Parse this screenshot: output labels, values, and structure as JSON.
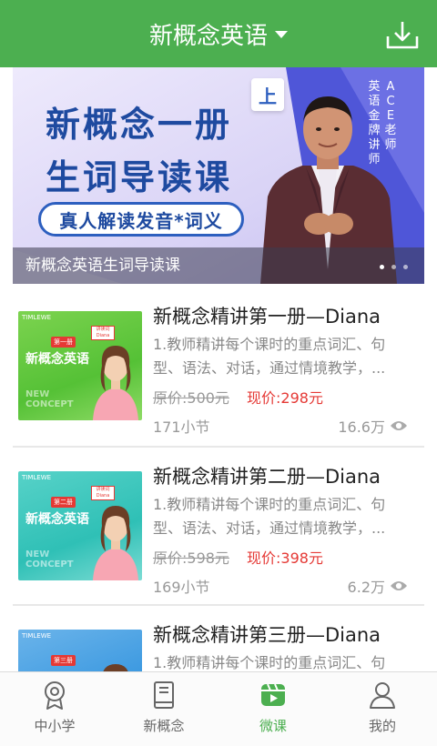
{
  "colors": {
    "brand_green": "#4caf50",
    "price_red": "#e53935",
    "muted_gray": "#999999"
  },
  "header": {
    "title": "新概念英语",
    "dropdown_icon": "caret-down-icon",
    "download_icon": "download-icon"
  },
  "banner": {
    "line1": "新概念一册",
    "line2": "生词导读课",
    "tag": "上",
    "pill": "真人解读发音*词义",
    "vertical_text": [
      "英语金牌讲师",
      "ACE老师"
    ],
    "caption": "新概念英语生词导读课",
    "dot_count": 3,
    "active_dot": 0
  },
  "courses": [
    {
      "title": "新概念精讲第一册—Diana",
      "description": "1.教师精讲每个课时的重点词汇、句型、语法、对话，通过情境教学，...",
      "original_price": "原价:500元",
      "current_price": "现价:298元",
      "lessons": "171小节",
      "views": "16.6万",
      "thumb": {
        "brand": "TIMLEWE",
        "name": "新概念英语",
        "badge": "第一册",
        "tag": "NEW CONCEPT",
        "card": "讲读词 Diana"
      }
    },
    {
      "title": "新概念精讲第二册—Diana",
      "description": "1.教师精讲每个课时的重点词汇、句型、语法、对话，通过情境教学，...",
      "original_price": "原价:598元",
      "current_price": "现价:398元",
      "lessons": "169小节",
      "views": "6.2万",
      "thumb": {
        "brand": "TIMLEWE",
        "name": "新概念英语",
        "badge": "第二册",
        "tag": "NEW CONCEPT",
        "card": "讲读词 Diana"
      }
    },
    {
      "title": "新概念精讲第三册—Diana",
      "description": "1.教师精讲每个课时的重点词汇、句",
      "original_price": "",
      "current_price": "",
      "lessons": "",
      "views": "",
      "thumb": {
        "brand": "TIMLEWE",
        "name": "",
        "badge": "第三册",
        "tag": "",
        "card": ""
      }
    }
  ],
  "tabbar": {
    "tabs": [
      {
        "label": "中小学",
        "icon": "map-pin-badge-icon",
        "active": false
      },
      {
        "label": "新概念",
        "icon": "book-icon",
        "active": false
      },
      {
        "label": "微课",
        "icon": "video-play-icon",
        "active": true
      },
      {
        "label": "我的",
        "icon": "user-icon",
        "active": false
      }
    ]
  }
}
